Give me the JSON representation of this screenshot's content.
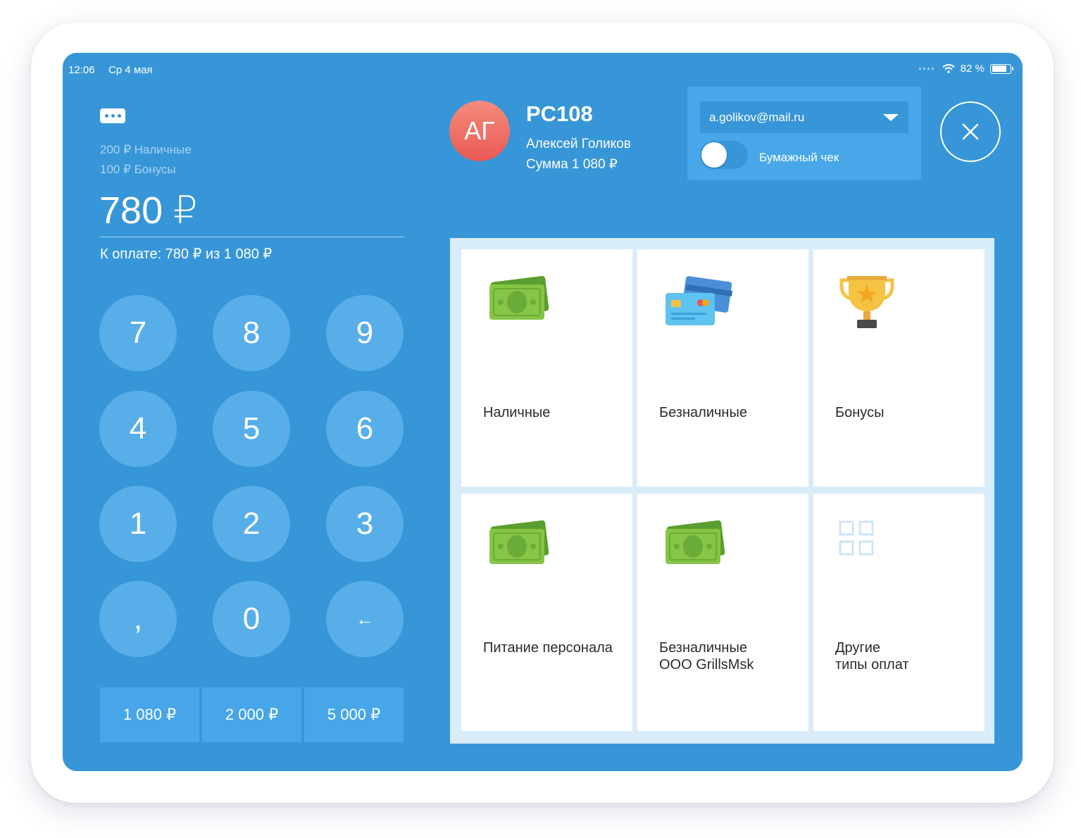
{
  "status_bar": {
    "time": "12:06",
    "date": "Ср 4 мая",
    "battery": "82 %",
    "battery_level": 0.82
  },
  "payment": {
    "paid_lines": [
      "200 ₽ Наличные",
      "100 ₽ Бонусы"
    ],
    "amount": "780 ₽",
    "to_pay": "К оплате: 780 ₽ из 1 080 ₽"
  },
  "keypad": {
    "keys": [
      "7",
      "8",
      "9",
      "4",
      "5",
      "6",
      "1",
      "2",
      "3",
      ",",
      "0",
      "←"
    ]
  },
  "presets": [
    "1 080 ₽",
    "2 000 ₽",
    "5 000 ₽"
  ],
  "customer": {
    "initials": "АГ",
    "order_code": "PC108",
    "name": "Алексей Голиков",
    "sum": "Сумма 1 080 ₽"
  },
  "receipt": {
    "email": "a.golikov@mail.ru",
    "paper_receipt_label": "Бумажный чек",
    "paper_receipt_on": false
  },
  "payment_methods": [
    {
      "label": "Наличные",
      "icon": "cash-icon"
    },
    {
      "label": "Безналичные",
      "icon": "cards-icon"
    },
    {
      "label": "Бонусы",
      "icon": "trophy-icon"
    },
    {
      "label": "Питание персонала",
      "icon": "cash-icon"
    },
    {
      "label": "Безналичные\nООО GrillsMsk",
      "icon": "cash-icon"
    },
    {
      "label": "Другие\nтипы оплат",
      "icon": "grid-icon"
    }
  ],
  "colors": {
    "background": "#3796d7",
    "key": "#58aee9",
    "preset": "#46a6e8",
    "avatar": "#ea5a55",
    "tile": "#ffffff",
    "cash_green": "#7ec242"
  }
}
